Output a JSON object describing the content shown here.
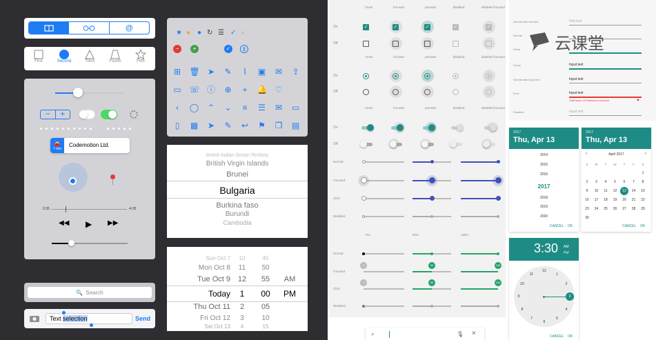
{
  "colors": {
    "ios_blue": "#1f7cf3",
    "teal": "#1e8c84",
    "indigo": "#3f51b5",
    "dark_bg": "#2e2e32"
  },
  "ios": {
    "segmented": {
      "items": [
        "book-icon",
        "glasses-icon",
        "@"
      ],
      "selected_index": 0
    },
    "tabbar": {
      "items": [
        {
          "label": "First",
          "icon": "square-icon"
        },
        {
          "label": "Second",
          "icon": "circle-icon"
        },
        {
          "label": "Third",
          "icon": "triangle-icon"
        },
        {
          "label": "Fourth",
          "icon": "trapezoid-icon"
        },
        {
          "label": "Fifth",
          "icon": "star-icon"
        }
      ],
      "selected_index": 1
    },
    "controls": {
      "slider_top_value": 0.4,
      "switch_off": false,
      "switch_on": true,
      "map_callout": "Codemotion Ltd.",
      "map_badge": "7 min",
      "time_elapsed": "0:35",
      "time_remaining": "-4:35",
      "progress": 0.2,
      "volume": 0.35
    },
    "search": {
      "placeholder": "Search"
    },
    "message": {
      "text_plain": "Text ",
      "text_selected": "selection",
      "send": "Send"
    },
    "icons": [
      "star-icon",
      "orange-dot-icon",
      "blue-dot-icon",
      "refresh-icon",
      "menu-icon",
      "check-icon",
      "chevron-right-icon",
      "minus-circle-icon",
      "plus-circle-icon",
      "check-circle-icon",
      "pause-circle-icon"
    ],
    "icon_grid": [
      "cart-icon",
      "trash-icon",
      "send-icon",
      "edit-icon",
      "paperclip-icon",
      "inbox-icon",
      "mail-icon",
      "share-icon",
      "video-icon",
      "phone-icon",
      "info-icon",
      "add-circle-icon",
      "plus-icon",
      "bell-icon",
      "heart-icon",
      "",
      "chevron-left-icon",
      "chat-icon",
      "chevron-up-icon",
      "chevron-down-icon",
      "list-icon",
      "menu-icon",
      "mail-icon",
      "folder-icon",
      "book-icon",
      "box-icon",
      "send-icon",
      "compose-icon",
      "reply-icon",
      "flag-icon",
      "copy-icon",
      "calendar-icon"
    ],
    "picker": {
      "items": [
        "British Indian Ocean Territory",
        "British Virgin Islands",
        "Brunei",
        "Bulgaria",
        "Burkina faso",
        "Burundi",
        "Cambodia"
      ],
      "selected_index": 3
    },
    "date_picker": {
      "rows": [
        {
          "date": "Sun Oct 7",
          "h": "10",
          "m": "45",
          "p": ""
        },
        {
          "date": "Mon Oct 8",
          "h": "11",
          "m": "50",
          "p": ""
        },
        {
          "date": "Tue Oct 9",
          "h": "12",
          "m": "55",
          "p": "AM"
        },
        {
          "date": "Today",
          "h": "1",
          "m": "00",
          "p": "PM"
        },
        {
          "date": "Thu Oct 11",
          "h": "2",
          "m": "05",
          "p": ""
        },
        {
          "date": "Fri Oct 12",
          "h": "3",
          "m": "10",
          "p": ""
        },
        {
          "date": "Sat Oct 13",
          "h": "4",
          "m": "15",
          "p": ""
        }
      ],
      "selected_index": 3
    }
  },
  "material": {
    "state_headers": [
      "hover",
      "focused",
      "pressed",
      "disabled",
      "disabled focused"
    ],
    "state_headers2": [
      "hover",
      "focused",
      "pressed",
      "disabled",
      "disabled focused"
    ],
    "state_headers3": [
      "hover",
      "focused",
      "pressed",
      "disabled",
      "disabled focused"
    ],
    "row_on": "On",
    "row_off": "Off",
    "slider_rows": [
      "Normal",
      "Focused",
      "Click",
      "Disabled"
    ],
    "slider_pct": [
      "0%",
      "50%",
      "100%"
    ],
    "disc_rows": [
      "Normal",
      "Focused",
      "Click",
      "Disabled"
    ],
    "disc_badges": [
      "0",
      "50",
      "100"
    ],
    "text_fields": {
      "rows": [
        {
          "label": "Normal with hint text",
          "value": "Hint text",
          "state": "hint"
        },
        {
          "label": "Normal",
          "value": "",
          "state": "normal"
        },
        {
          "label": "Press",
          "value": "",
          "state": "press"
        },
        {
          "label": "Focus",
          "value": "Input text",
          "state": "focus"
        },
        {
          "label": "Normal with input text",
          "value": "Input text",
          "state": "normal"
        },
        {
          "label": "Error",
          "value": "Input text",
          "state": "error",
          "error": "Username or Password incorrect"
        },
        {
          "label": "Disabled",
          "value": "Input text",
          "state": "disabled"
        }
      ]
    },
    "year_picker": {
      "year": "2017",
      "date": "Thu, Apr 13",
      "years": [
        "2014",
        "2015",
        "2016",
        "2017",
        "2018",
        "2019",
        "2020"
      ],
      "selected": "2017",
      "cancel": "CANCEL",
      "ok": "OK"
    },
    "calendar": {
      "year": "2017",
      "date": "Thu, Apr 13",
      "month": "April 2017",
      "weekdays": [
        "S",
        "M",
        "T",
        "W",
        "T",
        "F",
        "S"
      ],
      "weeks": [
        [
          "",
          "",
          "",
          "",
          "",
          "",
          "1"
        ],
        [
          "2",
          "3",
          "4",
          "5",
          "6",
          "7",
          "8"
        ],
        [
          "9",
          "10",
          "11",
          "12",
          "13",
          "14",
          "15"
        ],
        [
          "16",
          "17",
          "18",
          "19",
          "20",
          "21",
          "22"
        ],
        [
          "23",
          "24",
          "25",
          "26",
          "27",
          "28",
          "29"
        ],
        [
          "30",
          "",
          "",
          "",
          "",
          "",
          ""
        ]
      ],
      "selected": "13",
      "cancel": "CANCEL",
      "ok": "OK"
    },
    "clock": {
      "time": "3:30",
      "am": "AM",
      "pm": "PM",
      "numbers": [
        "12",
        "1",
        "2",
        "3",
        "4",
        "5",
        "6",
        "7",
        "8",
        "9",
        "10",
        "11"
      ],
      "selected": "3",
      "cancel": "CANCEL",
      "ok": "OK"
    },
    "search": {
      "mic": "mic-icon",
      "close": "close-icon",
      "search": "search-icon"
    },
    "watermark": "云课堂"
  }
}
